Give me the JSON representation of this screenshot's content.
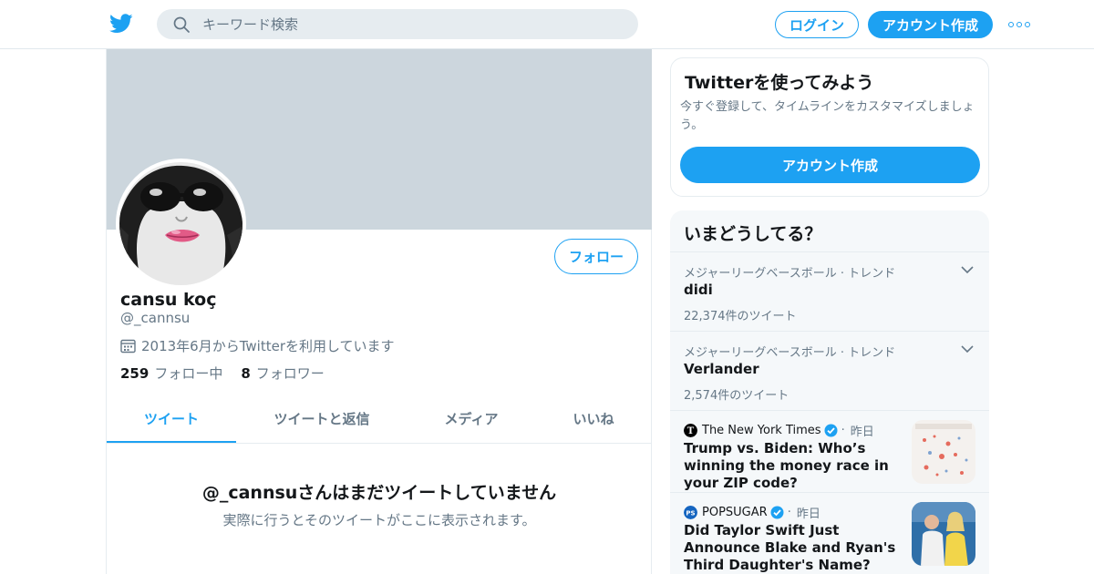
{
  "header": {
    "search_placeholder": "キーワード検索",
    "login_label": "ログイン",
    "signup_label": "アカウント作成",
    "icons": [
      "twitter-bird-icon",
      "search-icon",
      "more-icon"
    ]
  },
  "profile": {
    "display_name": "cansu koç",
    "handle": "@_cannsu",
    "joined": "2013年6月からTwitterを利用しています",
    "follow_label": "フォロー",
    "following_count": "259",
    "following_label": "フォロー中",
    "followers_count": "8",
    "followers_label": "フォロワー",
    "tabs": [
      {
        "label": "ツイート",
        "active": true
      },
      {
        "label": "ツイートと返信",
        "active": false
      },
      {
        "label": "メディア",
        "active": false
      },
      {
        "label": "いいね",
        "active": false
      }
    ],
    "empty_title": "@_cannsuさんはまだツイートしていません",
    "empty_subtitle": "実際に行うとそのツイートがここに表示されます。"
  },
  "signup_card": {
    "title": "Twitterを使ってみよう",
    "description": "今すぐ登録して、タイムラインをカスタマイズしましょう。",
    "button_label": "アカウント作成"
  },
  "trends": {
    "title": "いまどうしてる？",
    "items": [
      {
        "meta": "メジャーリーグベースボール · トレンド",
        "name": "didi",
        "count": "22,374件のツイート"
      },
      {
        "meta": "メジャーリーグベースボール · トレンド",
        "name": "Verlander",
        "count": "2,574件のツイート"
      }
    ],
    "news": [
      {
        "source": "The New York Times",
        "time": "昨日",
        "headline": "Trump vs. Biden: Who’s winning the money race in your ZIP code?"
      },
      {
        "source": "POPSUGAR",
        "time": "昨日",
        "headline": "Did Taylor Swift Just Announce Blake and Ryan's Third Daughter's Name?"
      }
    ]
  },
  "colors": {
    "accent": "#1da1f2",
    "banner": "#ccd6dd",
    "secondary_text": "#657786",
    "panel_bg": "#f5f8fa"
  }
}
